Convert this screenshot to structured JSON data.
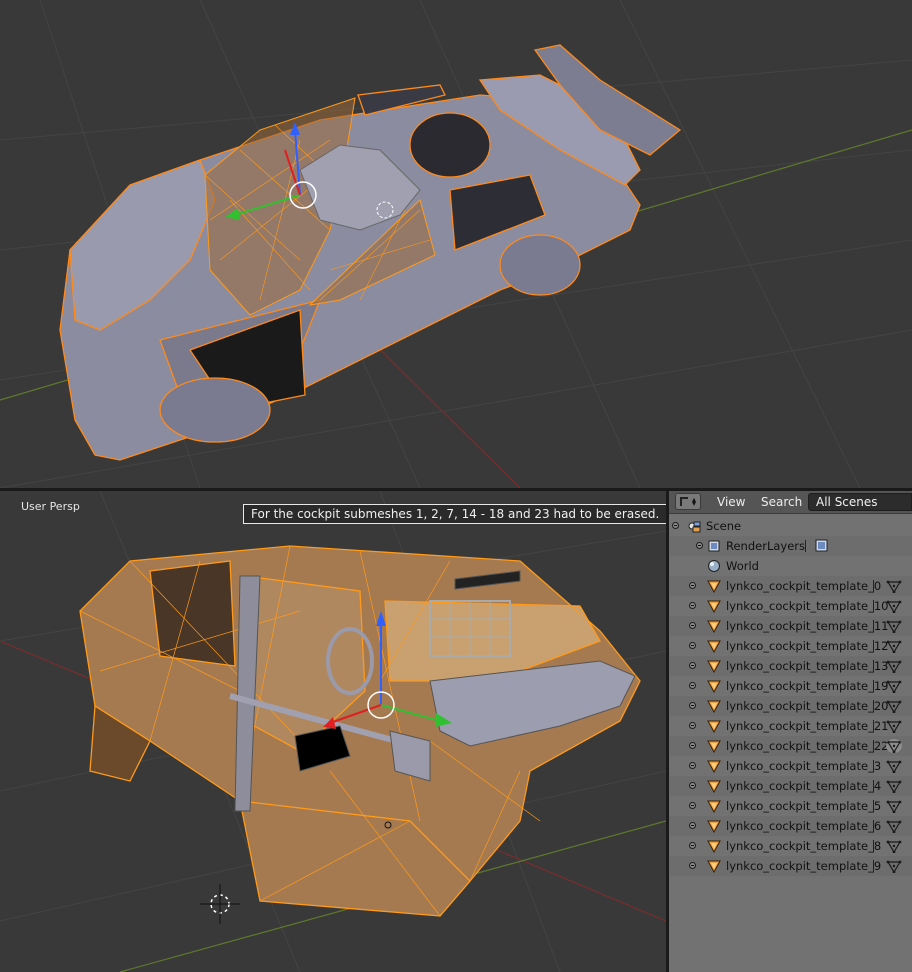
{
  "viewport_top": {
    "label": ""
  },
  "viewport_bottom": {
    "view_label": "User Persp",
    "note": "For the cockpit submeshes 1, 2, 7, 14 - 18 and 23 had to be erased."
  },
  "outliner": {
    "menu": [
      "View",
      "Search"
    ],
    "display_mode": "All Scenes",
    "scene": "Scene",
    "render_layers": "RenderLayers",
    "world": "World",
    "objects": [
      "lynkco_cockpit_template_0",
      "lynkco_cockpit_template_10",
      "lynkco_cockpit_template_11",
      "lynkco_cockpit_template_12",
      "lynkco_cockpit_template_13",
      "lynkco_cockpit_template_19",
      "lynkco_cockpit_template_20",
      "lynkco_cockpit_template_21",
      "lynkco_cockpit_template_22",
      "lynkco_cockpit_template_3",
      "lynkco_cockpit_template_4",
      "lynkco_cockpit_template_5",
      "lynkco_cockpit_template_6",
      "lynkco_cockpit_template_8",
      "lynkco_cockpit_template_9"
    ],
    "icons": [
      "outliner-editor-icon",
      "scene-icon",
      "render-layers-icon",
      "world-icon",
      "mesh-object-icon",
      "mesh-data-icon"
    ],
    "colors": {
      "selection_orange": "#f08a00",
      "wire": "#ff9a1a",
      "body": "#8f8fa2",
      "header": "#555555",
      "panel": "#727272"
    }
  }
}
